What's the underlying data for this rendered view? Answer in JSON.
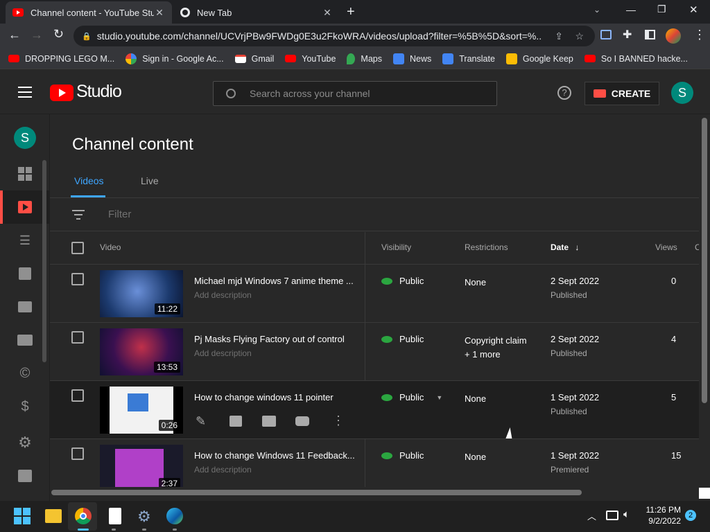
{
  "browser": {
    "tabs": [
      {
        "title": "Channel content - YouTube Studio",
        "active": true
      },
      {
        "title": "New Tab",
        "active": false
      }
    ],
    "url": "studio.youtube.com/channel/UCVrjPBw9FWDg0E3u2FkoWRA/videos/upload?filter=%5B%5D&sort=%...",
    "bookmarks": [
      {
        "label": "DROPPING LEGO M...",
        "icon": "youtube-icon"
      },
      {
        "label": "Sign in - Google Ac...",
        "icon": "google-icon"
      },
      {
        "label": "Gmail",
        "icon": "gmail-icon"
      },
      {
        "label": "YouTube",
        "icon": "youtube-icon"
      },
      {
        "label": "Maps",
        "icon": "maps-icon"
      },
      {
        "label": "News",
        "icon": "news-icon"
      },
      {
        "label": "Translate",
        "icon": "translate-icon"
      },
      {
        "label": "Google Keep",
        "icon": "keep-icon"
      },
      {
        "label": "So I BANNED hacke...",
        "icon": "youtube-icon"
      }
    ],
    "more_bookmarks": "»"
  },
  "studio": {
    "logo_text": "Studio",
    "search_placeholder": "Search across your channel",
    "help": "?",
    "create_label": "CREATE",
    "avatar_letter": "S"
  },
  "sidebar": {
    "avatar_letter": "S",
    "items": [
      "dashboard-icon",
      "content-icon",
      "playlists-icon",
      "analytics-icon",
      "comments-icon",
      "subtitles-icon",
      "copyright-icon",
      "monetization-icon",
      "settings-icon",
      "feedback-icon"
    ]
  },
  "page": {
    "title": "Channel content",
    "tabs": [
      "Videos",
      "Live"
    ],
    "filter_placeholder": "Filter"
  },
  "table": {
    "headers": {
      "video": "Video",
      "visibility": "Visibility",
      "restrictions": "Restrictions",
      "date": "Date",
      "views": "Views",
      "extra": "C"
    },
    "rows": [
      {
        "title": "Michael mjd Windows 7 anime theme ...",
        "description": "Add description",
        "duration": "11:22",
        "visibility": "Public",
        "restriction1": "None",
        "restriction2": "",
        "date": "2 Sept 2022",
        "date_status": "Published",
        "views": "0"
      },
      {
        "title": "Pj Masks Flying Factory out of control",
        "description": "Add description",
        "duration": "13:53",
        "visibility": "Public",
        "restriction1": "Copyright claim",
        "restriction2": "+ 1 more",
        "date": "2 Sept 2022",
        "date_status": "Published",
        "views": "4"
      },
      {
        "title": "How to change windows 11 pointer",
        "description": "",
        "duration": "0:26",
        "visibility": "Public",
        "restriction1": "None",
        "restriction2": "",
        "date": "1 Sept 2022",
        "date_status": "Published",
        "views": "5"
      },
      {
        "title": "How to change Windows 11 Feedback...",
        "description": "Add description",
        "duration": "2:37",
        "visibility": "Public",
        "restriction1": "None",
        "restriction2": "",
        "date": "1 Sept 2022",
        "date_status": "Premiered",
        "views": "15"
      }
    ]
  },
  "taskbar": {
    "time": "11:26 PM",
    "date": "9/2/2022",
    "notification_count": "2"
  },
  "colors": {
    "accent_red": "#ff0000",
    "tab_blue": "#3ea6ff",
    "public_green": "#2ba640",
    "avatar_teal": "#00897b"
  }
}
